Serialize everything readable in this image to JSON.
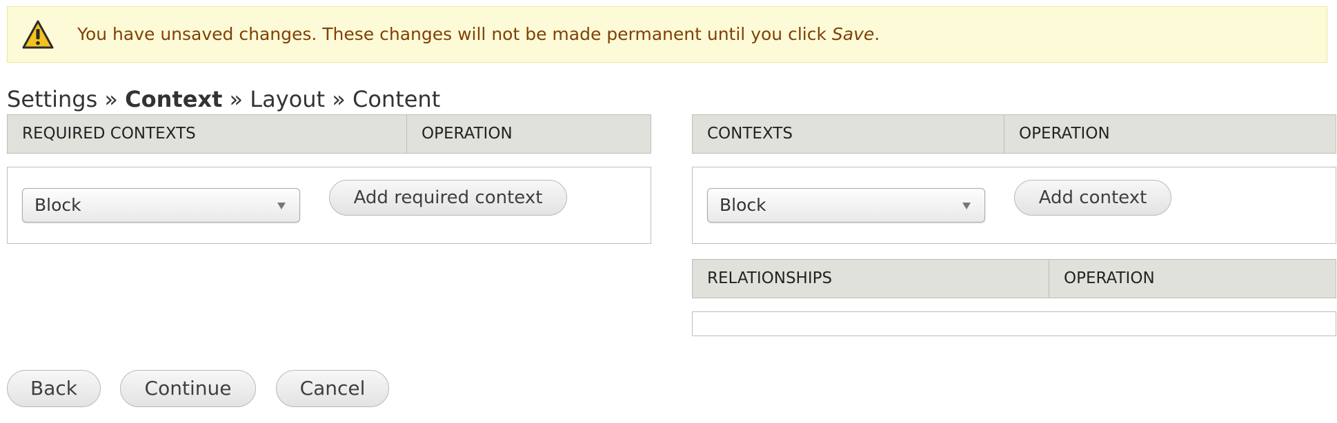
{
  "message": {
    "text_before": "You have unsaved changes. These changes will not be made permanent until you click ",
    "save_word": "Save",
    "text_after": ".",
    "icon": "warning-triangle-icon",
    "colors": {
      "background": "#fdfad8",
      "border": "#ede89a",
      "text": "#814003",
      "icon": "#f4c21d"
    }
  },
  "breadcrumb": {
    "items": [
      "Settings",
      "Context",
      "Layout",
      "Content"
    ],
    "separator": "»",
    "current_index": 1
  },
  "required_contexts": {
    "headers": [
      "Required Contexts",
      "Operation"
    ],
    "select_value": "Block",
    "add_button": "Add required context"
  },
  "contexts": {
    "headers": [
      "Contexts",
      "Operation"
    ],
    "select_value": "Block",
    "add_button": "Add context"
  },
  "relationships": {
    "headers": [
      "Relationships",
      "Operation"
    ]
  },
  "actions": {
    "back": "Back",
    "continue": "Continue",
    "cancel": "Cancel"
  }
}
